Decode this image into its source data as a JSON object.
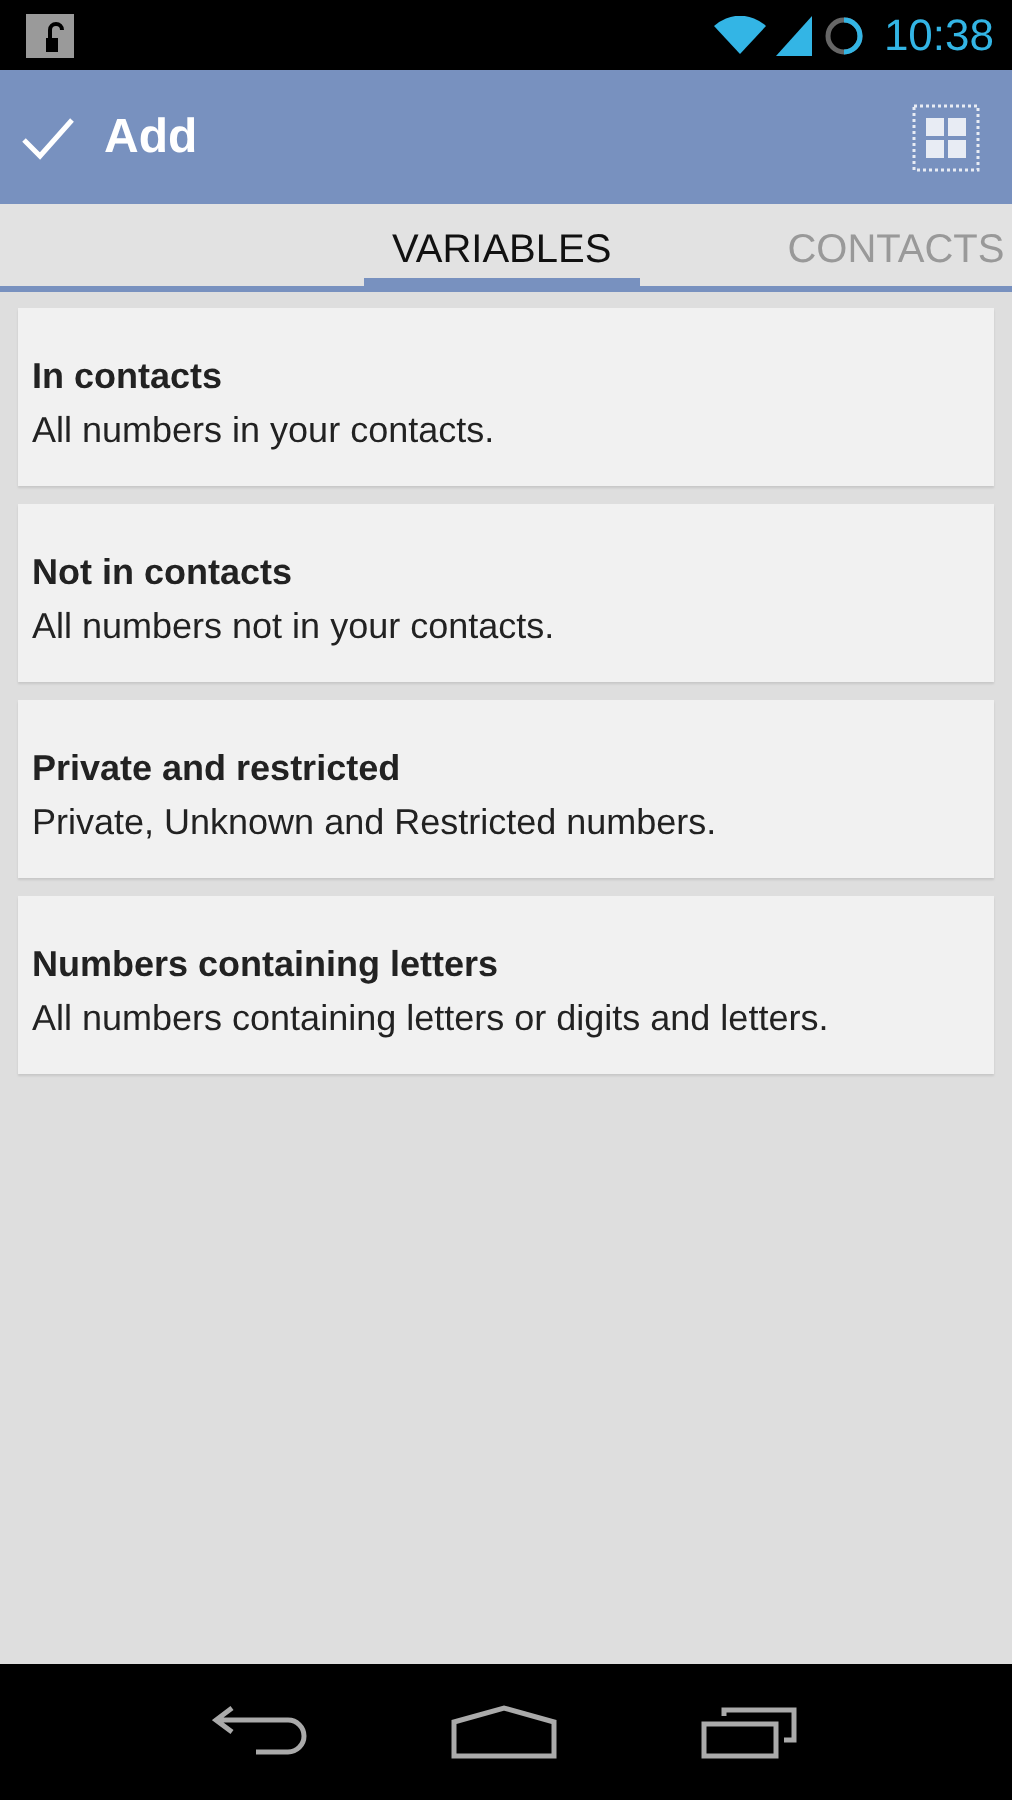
{
  "status_bar": {
    "time": "10:38"
  },
  "action_bar": {
    "title": "Add"
  },
  "tabs": [
    {
      "label": "VARIABLES",
      "selected": true
    },
    {
      "label": "CONTACTS",
      "selected": false
    }
  ],
  "items": [
    {
      "title": "In contacts",
      "subtitle": "All numbers in your contacts."
    },
    {
      "title": "Not in contacts",
      "subtitle": "All numbers not in your contacts."
    },
    {
      "title": "Private and restricted",
      "subtitle": "Private, Unknown and Restricted numbers."
    },
    {
      "title": "Numbers containing letters",
      "subtitle": "All numbers containing letters or digits and letters."
    }
  ]
}
